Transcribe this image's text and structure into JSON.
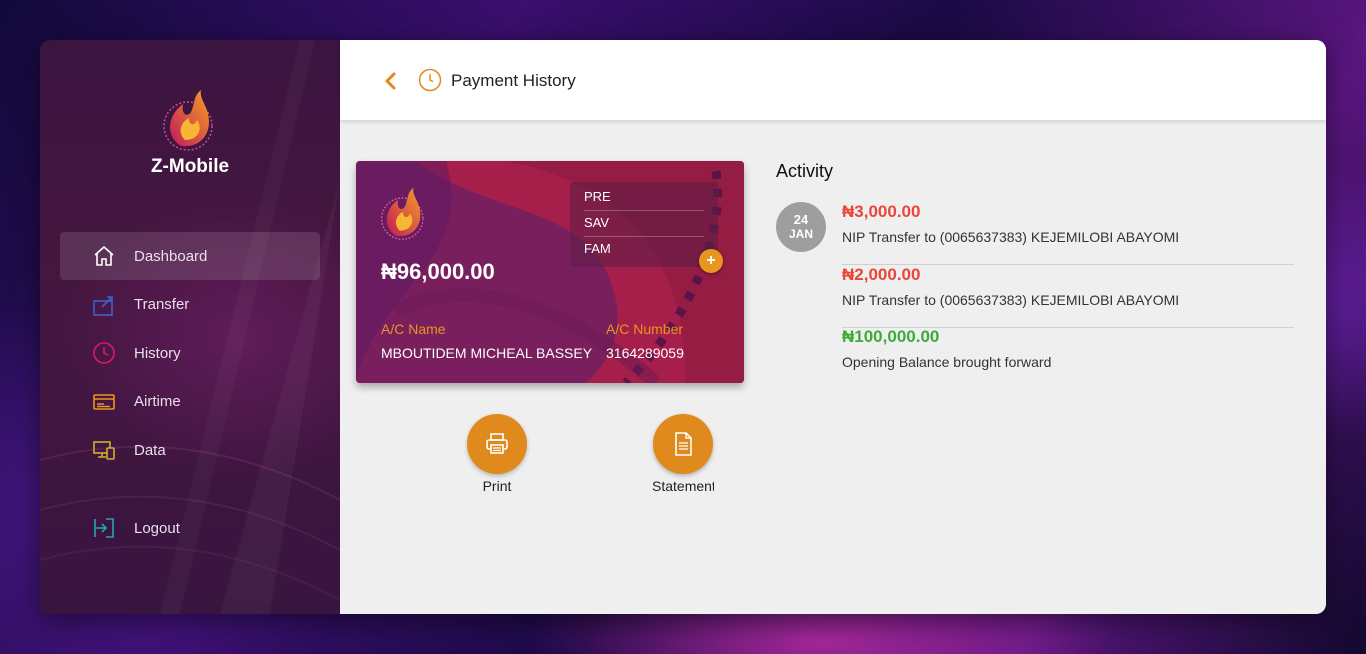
{
  "app": {
    "brand_name": "Z-Mobile"
  },
  "sidebar": {
    "items": [
      {
        "label": "Dashboard",
        "icon": "home-icon",
        "active": true
      },
      {
        "label": "Transfer",
        "icon": "transfer-icon"
      },
      {
        "label": "History",
        "icon": "clock-icon"
      },
      {
        "label": "Airtime",
        "icon": "card-icon"
      },
      {
        "label": "Data",
        "icon": "devices-icon"
      }
    ],
    "logout_label": "Logout"
  },
  "header": {
    "title": "Payment History"
  },
  "account_card": {
    "balance": "₦96,000.00",
    "account_types": [
      "PRE",
      "SAV",
      "FAM"
    ],
    "add_symbol": "+",
    "name_label": "A/C Name",
    "name_value": "MBOUTIDEM MICHEAL BASSEY",
    "number_label": "A/C Number",
    "number_value": "3164289059"
  },
  "actions": {
    "print_label": "Print",
    "statement_label": "Statement"
  },
  "activity": {
    "title": "Activity",
    "date_day": "24",
    "date_month": "JAN",
    "transactions": [
      {
        "amount": "₦3,000.00",
        "description": "NIP Transfer to (0065637383) KEJEMILOBI ABAYOMI",
        "type": "debit"
      },
      {
        "amount": "₦2,000.00",
        "description": "NIP Transfer to (0065637383) KEJEMILOBI ABAYOMI",
        "type": "debit"
      },
      {
        "amount": "₦100,000.00",
        "description": "Opening Balance brought forward",
        "type": "credit"
      }
    ]
  },
  "colors": {
    "accent": "#e08a1e",
    "debit": "#e8473a",
    "credit": "#3daa3a",
    "sidebar_bg": "#3b1540"
  }
}
